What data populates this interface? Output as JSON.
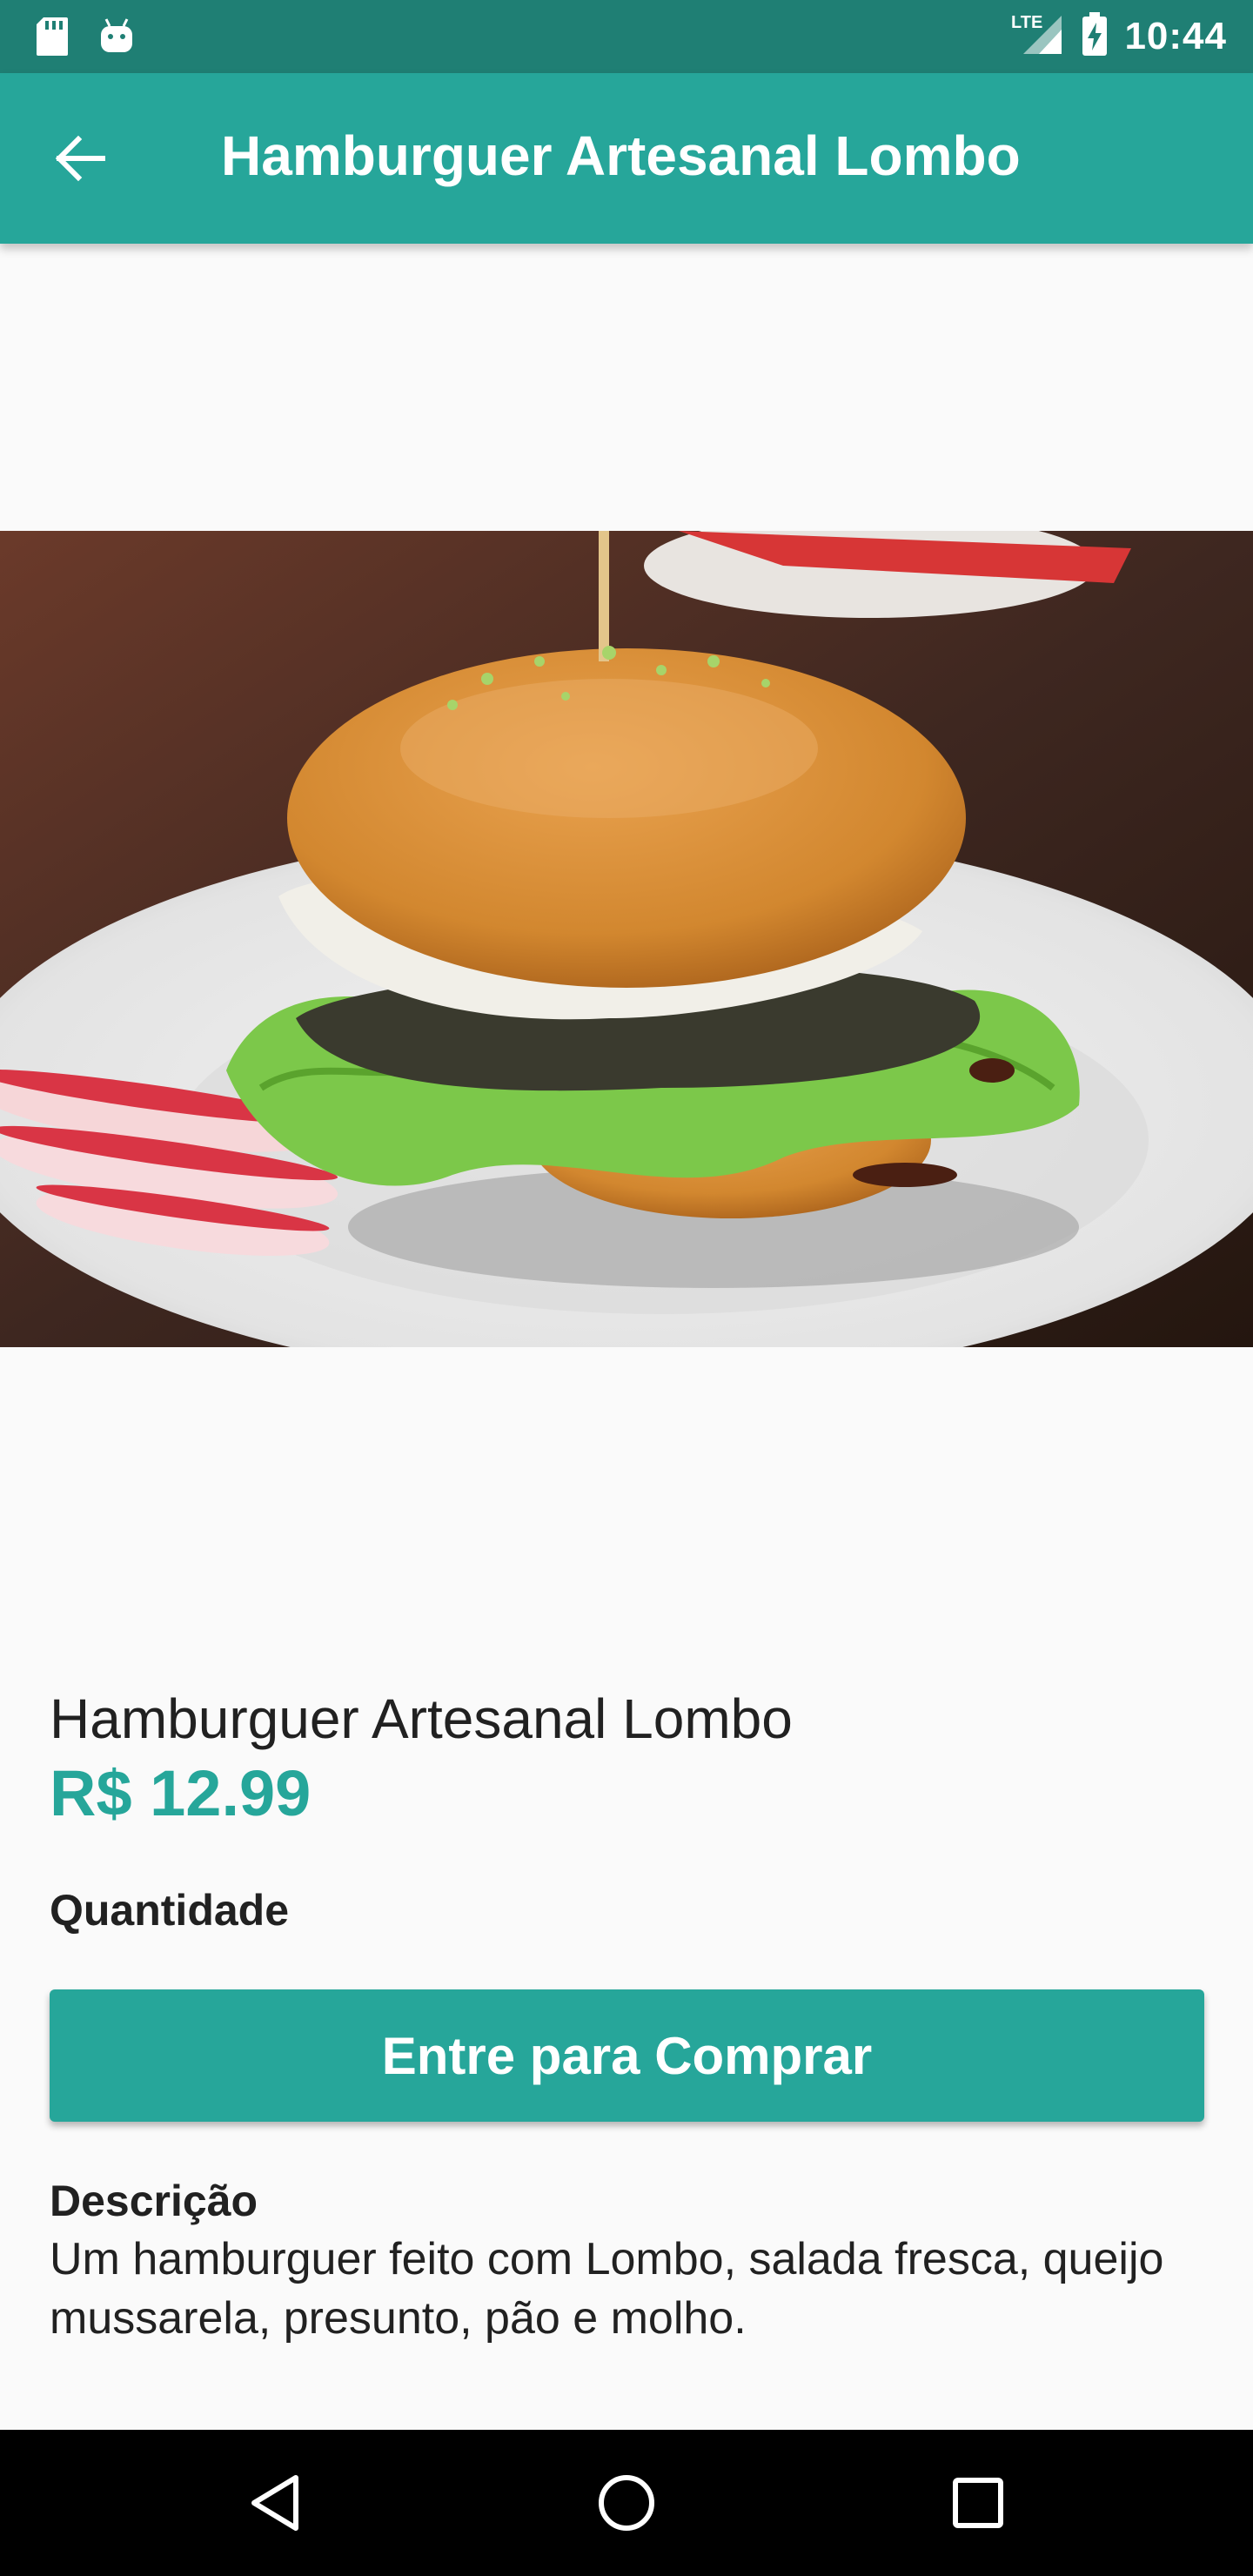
{
  "status_bar": {
    "time": "10:44",
    "left_icons": [
      "sd-card-icon",
      "android-icon"
    ],
    "right_icons": [
      "lte-signal-icon",
      "battery-charging-icon"
    ],
    "network_label": "LTE",
    "background_color": "#1f7f74"
  },
  "app_bar": {
    "title": "Hamburguer Artesanal Lombo",
    "back_icon": "arrow-back-icon",
    "background_color": "#26a69a"
  },
  "product": {
    "image_icon": "burger-photo",
    "name": "Hamburguer Artesanal Lombo",
    "price": "R$ 12.99",
    "quantity_label": "Quantidade",
    "buy_button_label": "Entre para Comprar",
    "description_heading": "Descrição",
    "description": "Um hamburguer feito com Lombo, salada fresca, queijo mussarela, presunto, pão e molho."
  },
  "nav_bar": {
    "items": [
      "back-triangle-icon",
      "home-circle-icon",
      "recents-square-icon"
    ]
  },
  "colors": {
    "accent": "#26a69a",
    "text": "#212121",
    "background": "#fafafa"
  }
}
